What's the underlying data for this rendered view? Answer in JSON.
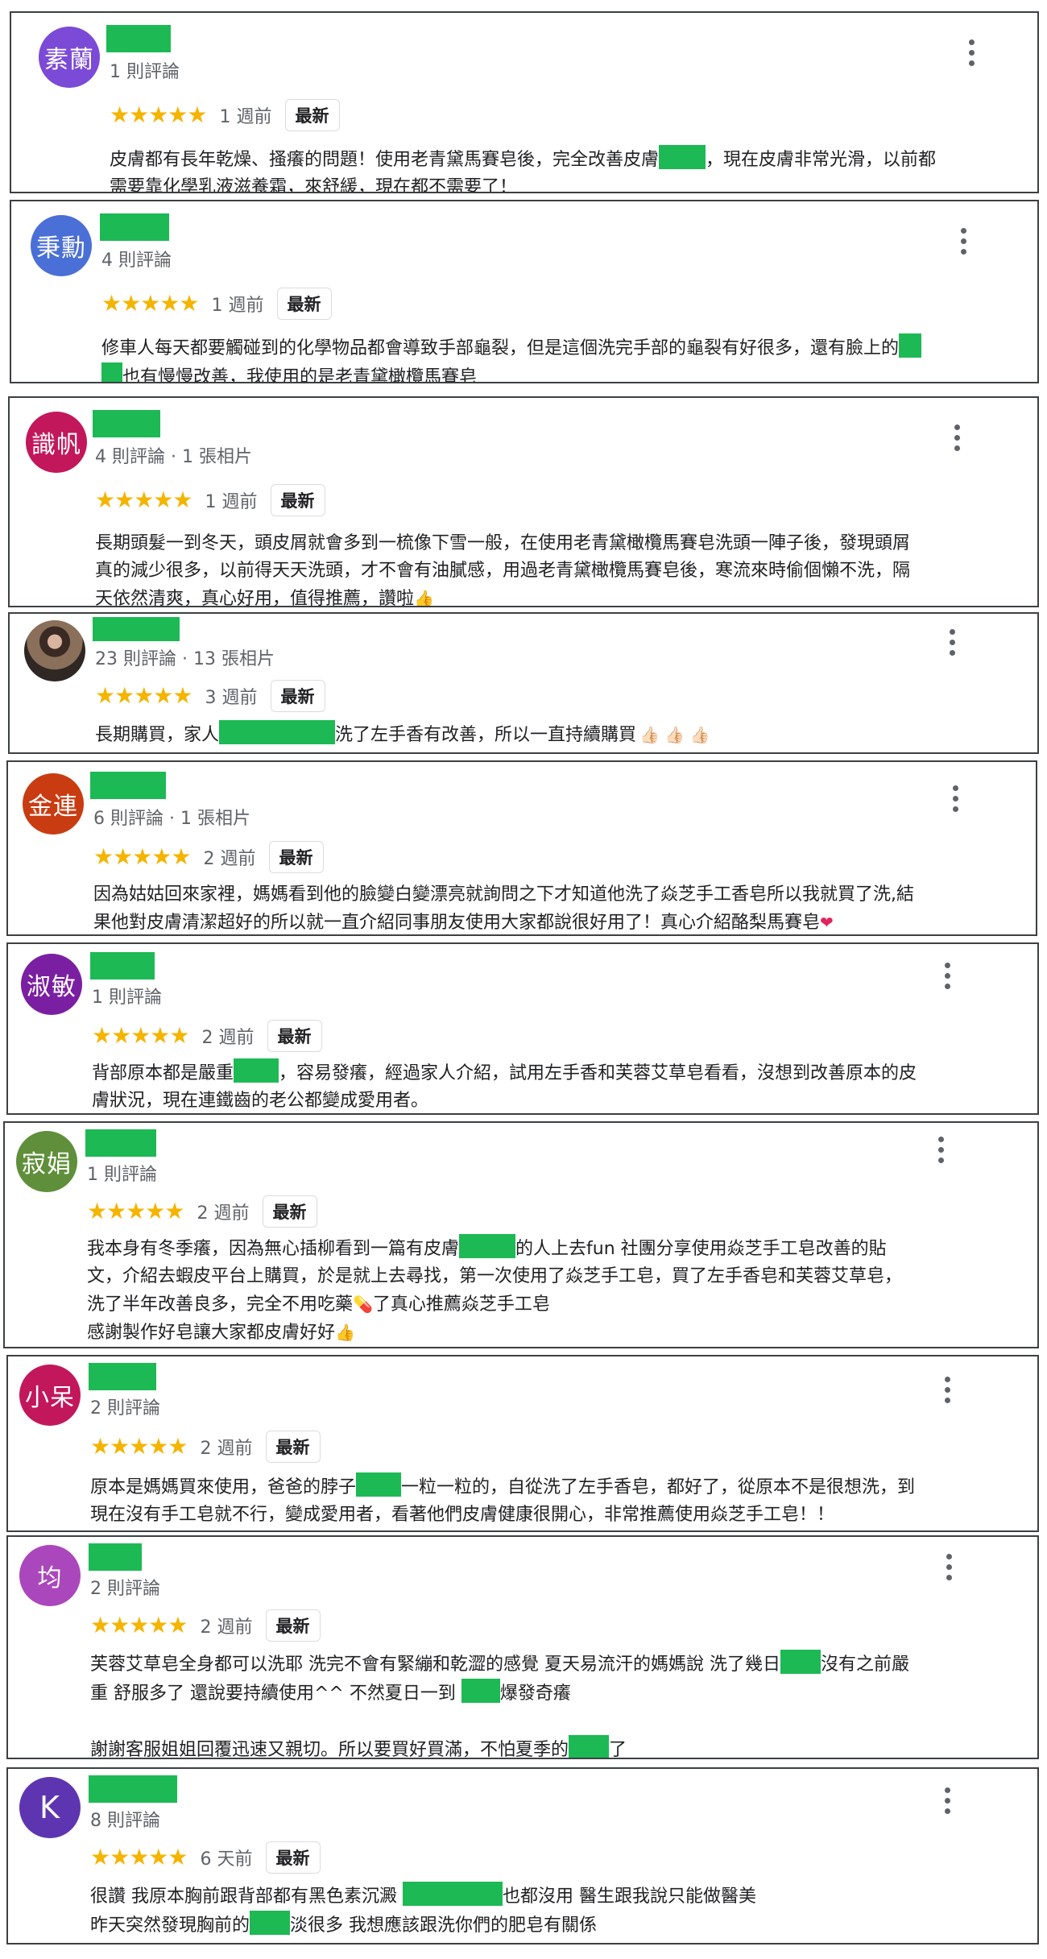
{
  "reviews": [
    {
      "avatar_text": "素蘭",
      "avatar_color": "#7b4ad6",
      "meta": "1 則評論",
      "stars": "★★★★★",
      "time": "1 週前",
      "badge": "最新",
      "lines": [
        "皮膚都有長年乾燥、搔癢的問題！使用老青黛馬賽皂後，完全改善皮膚",
        "，現在皮膚非常光滑，以前都",
        "需要靠化學乳液滋養霜，來舒緩，現在都不需要了！"
      ]
    },
    {
      "avatar_text": "秉勳",
      "avatar_color": "#4a6fd6",
      "meta": "4 則評論",
      "stars": "★★★★★",
      "time": "1 週前",
      "badge": "最新",
      "lines": [
        "修車人每天都要觸碰到的化學物品都會導致手部龜裂，但是這個洗完手部的龜裂有好很多，還有臉上的",
        "也有慢慢改善，我使用的是老青黛橄欖馬賽皂"
      ]
    },
    {
      "avatar_text": "識帆",
      "avatar_color": "#c2185b",
      "meta": "4 則評論 · 1 張相片",
      "stars": "★★★★★",
      "time": "1 週前",
      "badge": "最新",
      "lines": [
        "長期頭髮一到冬天，頭皮屑就會多到一梳像下雪一般，在使用老青黛橄欖馬賽皂洗頭一陣子後，發現頭屑",
        "真的減少很多，以前得天天洗頭，才不會有油膩感，用過老青黛橄欖馬賽皂後，寒流來時偷個懶不洗，隔",
        "天依然清爽，真心好用，值得推薦，讚啦",
        "👍"
      ]
    },
    {
      "avatar_text": "",
      "avatar_color": "#3a2a24",
      "meta": "23 則評論 · 13 張相片",
      "stars": "★★★★★",
      "time": "3 週前",
      "badge": "最新",
      "lines": [
        "長期購買，家人",
        "洗了左手香有改善，所以一直持續購買",
        "👍🏻 👍🏻 👍🏻"
      ]
    },
    {
      "avatar_text": "金連",
      "avatar_color": "#c93c12",
      "meta": "6 則評論 · 1 張相片",
      "stars": "★★★★★",
      "time": "2 週前",
      "badge": "最新",
      "lines": [
        "因為姑姑回來家裡，媽媽看到他的臉變白變漂亮就詢問之下才知道他洗了焱芝手工香皂所以我就買了洗,結",
        "果他對皮膚清潔超好的所以就一直介紹同事朋友使用大家都說很好用了！真心介紹酪梨馬賽皂",
        "❤"
      ]
    },
    {
      "avatar_text": "淑敏",
      "avatar_color": "#7b1fa2",
      "meta": "1 則評論",
      "stars": "★★★★★",
      "time": "2 週前",
      "badge": "最新",
      "lines": [
        "背部原本都是嚴重",
        "，容易發癢，經過家人介紹，試用左手香和芙蓉艾草皂看看，沒想到改善原本的皮",
        "膚狀況，現在連鐵齒的老公都變成愛用者。"
      ]
    },
    {
      "avatar_text": "寂娟",
      "avatar_color": "#5f8f3a",
      "meta": "1 則評論",
      "stars": "★★★★★",
      "time": "2 週前",
      "badge": "最新",
      "lines": [
        "我本身有冬季癢，因為無心插柳看到一篇有皮膚",
        "的人上去fun 社團分享使用焱芝手工皂改善的貼",
        "文，介紹去蝦皮平台上購買，於是就上去尋找，第一次使用了焱芝手工皂，買了左手香皂和芙蓉艾草皂，",
        "洗了半年改善良多，完全不用吃藥",
        "💊",
        "了真心推薦焱芝手工皂",
        "感謝製作好皂讓大家都皮膚好好",
        "👍"
      ]
    },
    {
      "avatar_text": "小呆",
      "avatar_color": "#c2185b",
      "meta": "2 則評論",
      "stars": "★★★★★",
      "time": "2 週前",
      "badge": "最新",
      "lines": [
        "原本是媽媽買來使用，爸爸的脖子",
        "一粒一粒的，自從洗了左手香皂，都好了，從原本不是很想洗，到",
        "現在沒有手工皂就不行，變成愛用者，看著他們皮膚健康很開心，非常推薦使用焱芝手工皂！！"
      ]
    },
    {
      "avatar_text": "均",
      "avatar_color": "#ab47bc",
      "meta": "2 則評論",
      "stars": "★★★★★",
      "time": "2 週前",
      "badge": "最新",
      "lines": [
        "芙蓉艾草皂全身都可以洗耶 洗完不會有緊繃和乾澀的感覺 夏天易流汗的媽媽說 洗了幾日",
        "沒有之前嚴",
        "重 舒服多了 還說要持續使用^^ 不然夏日一到 ",
        "爆發奇癢",
        "謝謝客服姐姐回覆迅速又親切。所以要買好買滿，不怕夏季的",
        "了"
      ]
    },
    {
      "avatar_text": "K",
      "avatar_color": "#5e35b1",
      "meta": "8 則評論",
      "stars": "★★★★★",
      "time": "6 天前",
      "badge": "最新",
      "lines": [
        "很讚 我原本胸前跟背部都有黑色素沉澱 ",
        "也都沒用 醫生跟我說只能做醫美",
        "昨天突然發現胸前的",
        "淡很多 我想應該跟洗你們的肥皂有關係"
      ]
    }
  ]
}
